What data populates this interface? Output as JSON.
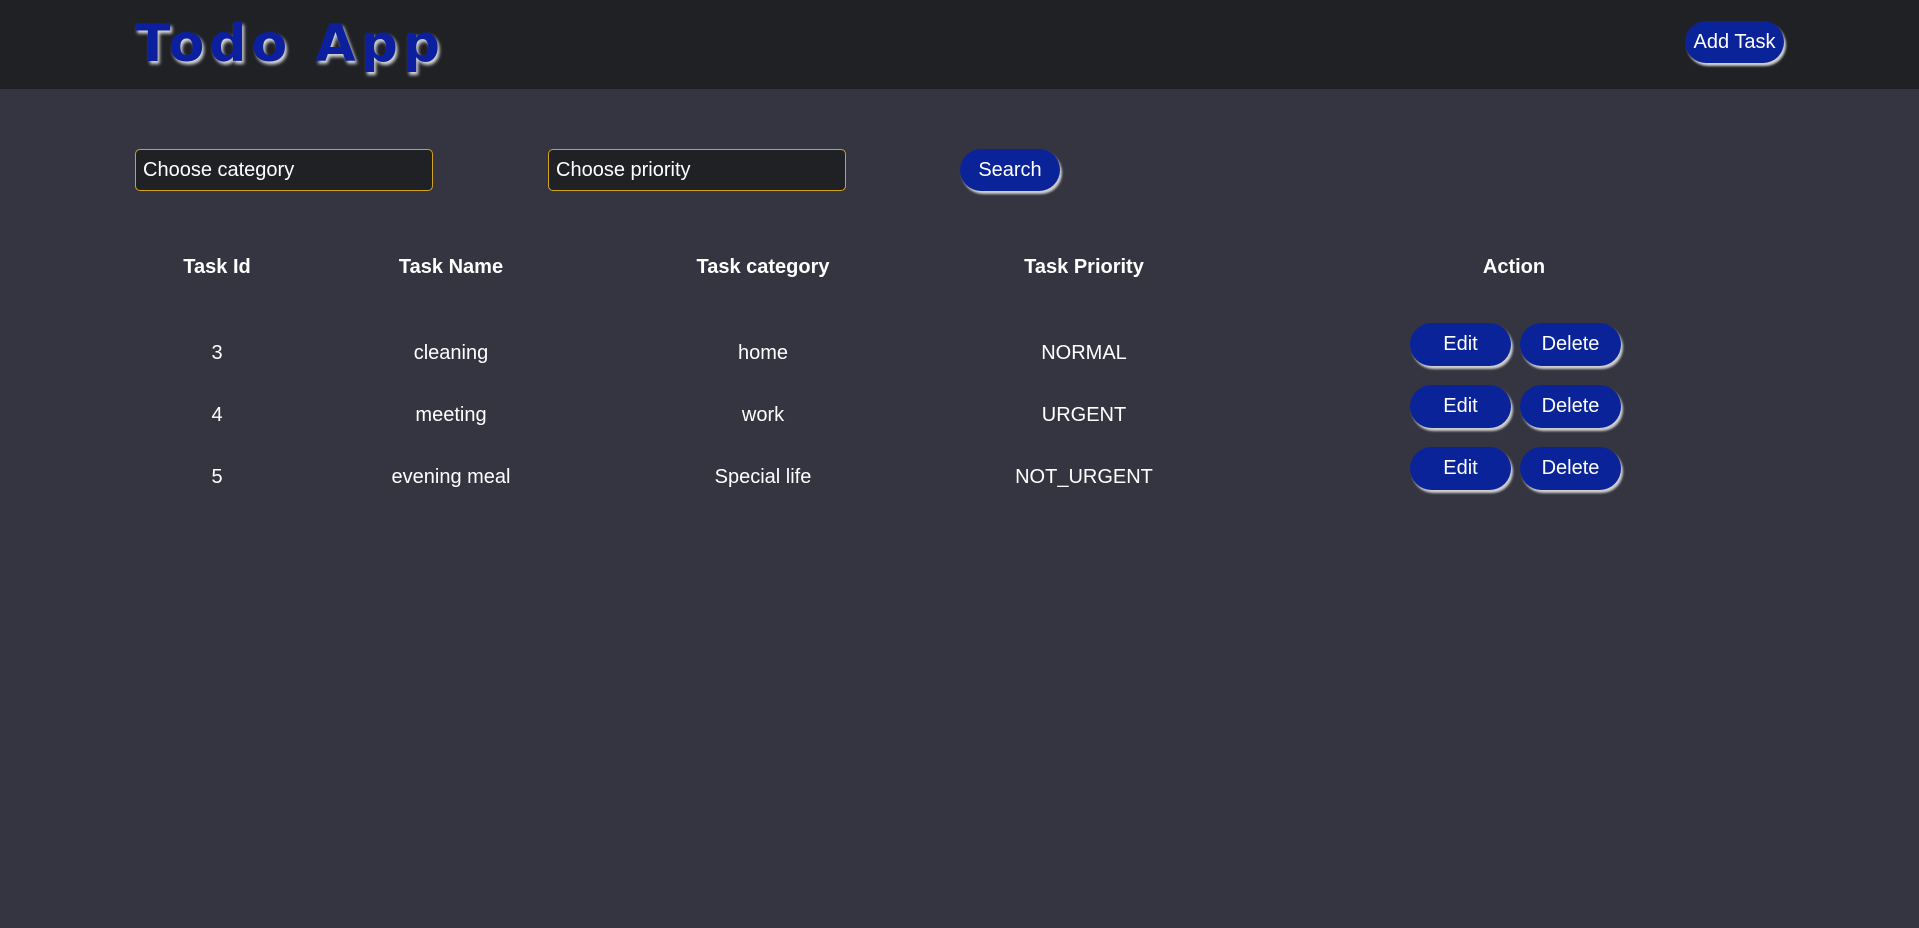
{
  "header": {
    "title": "Todo App",
    "add_task_label": "Add Task"
  },
  "filters": {
    "category_placeholder": "Choose category",
    "priority_placeholder": "Choose priority",
    "search_label": "Search"
  },
  "table": {
    "columns": [
      "Task Id",
      "Task Name",
      "Task category",
      "Task Priority",
      "Action"
    ],
    "rows": [
      {
        "id": "3",
        "name": "cleaning",
        "category": "home",
        "priority": "NORMAL",
        "edit": "Edit",
        "delete": "Delete"
      },
      {
        "id": "4",
        "name": "meeting",
        "category": "work",
        "priority": "URGENT",
        "edit": "Edit",
        "delete": "Delete"
      },
      {
        "id": "5",
        "name": "evening meal",
        "category": "Special life",
        "priority": "NOT_URGENT",
        "edit": "Edit",
        "delete": "Delete"
      }
    ]
  },
  "colors": {
    "accent": "#0a2399",
    "select_border": "#cfa31d",
    "page_bg": "#353541",
    "topbar_bg": "#202125"
  }
}
